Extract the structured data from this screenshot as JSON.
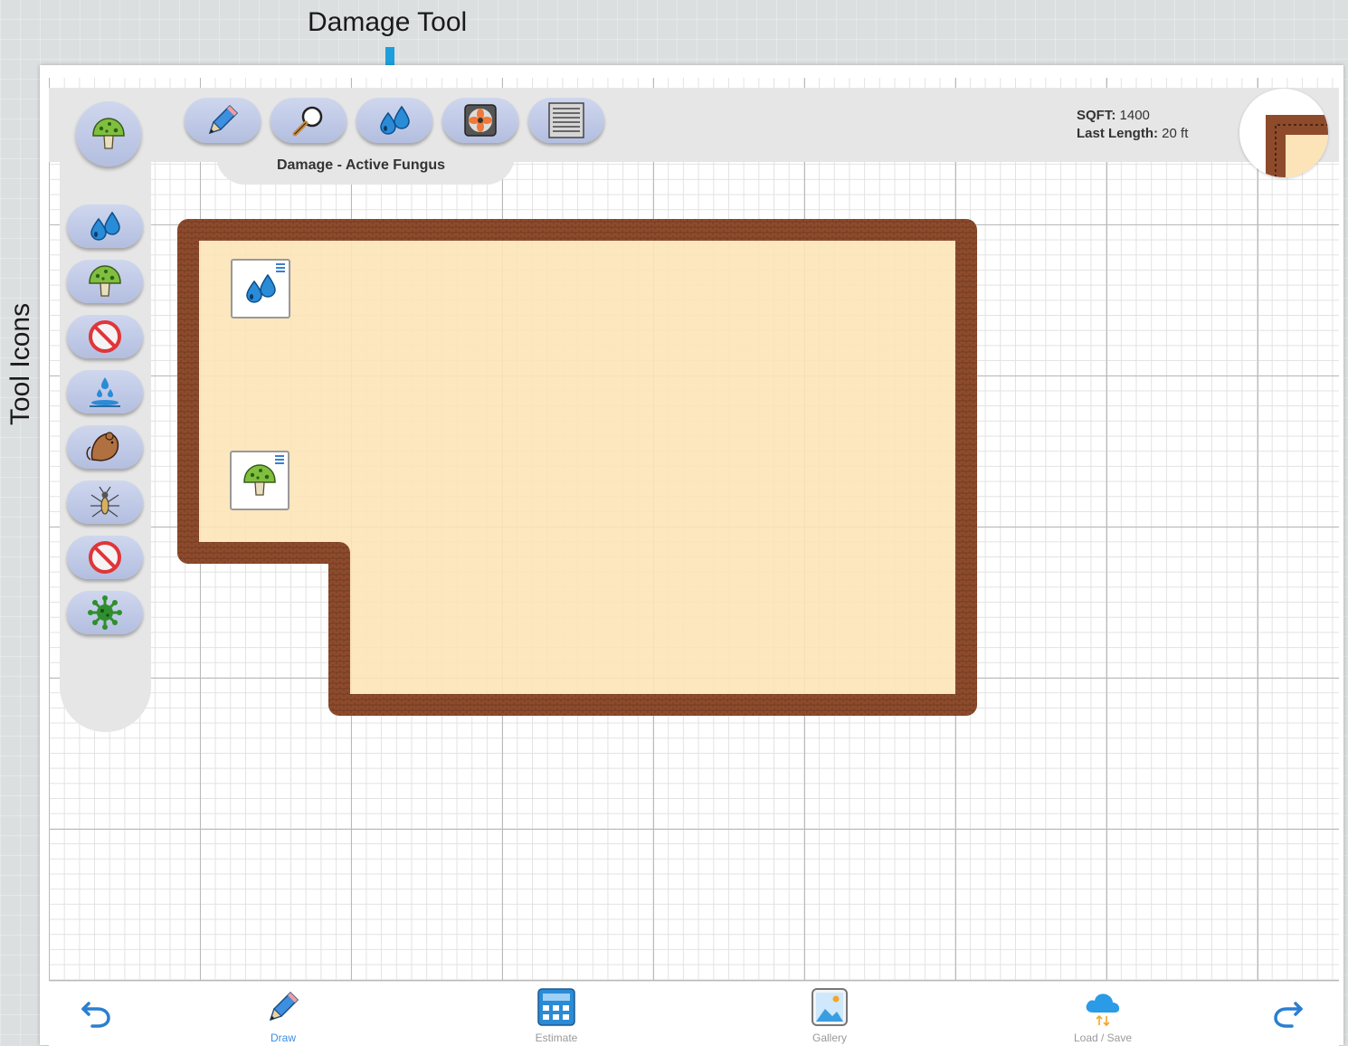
{
  "callouts": {
    "damage_tool": "Damage Tool",
    "tool_icons": "Tool Icons"
  },
  "toolbar": {
    "tools": [
      {
        "icon": "pencil-icon"
      },
      {
        "icon": "magnifier-icon"
      },
      {
        "icon": "water-drops-icon"
      },
      {
        "icon": "fan-icon"
      },
      {
        "icon": "vent-icon"
      }
    ],
    "selected_tool_caption": "Damage - Active Fungus"
  },
  "sidebar": {
    "selected_icon": "mushroom-icon",
    "items": [
      {
        "icon": "water-drops-icon"
      },
      {
        "icon": "mushroom-icon"
      },
      {
        "icon": "no-mold-icon"
      },
      {
        "icon": "water-leak-icon"
      },
      {
        "icon": "rodent-icon"
      },
      {
        "icon": "insect-icon"
      },
      {
        "icon": "no-pest-icon"
      },
      {
        "icon": "bacteria-icon"
      }
    ]
  },
  "info": {
    "sqft_label": "SQFT:",
    "sqft_value": "1400",
    "length_label": "Last Length:",
    "length_value": "20 ft"
  },
  "canvas": {
    "markers": [
      {
        "icon": "water-drops-icon"
      },
      {
        "icon": "mushroom-icon"
      }
    ]
  },
  "bottom_nav": {
    "undo_icon": "undo-icon",
    "redo_icon": "redo-icon",
    "items": [
      {
        "label": "Draw",
        "icon": "pencil-icon",
        "active": true
      },
      {
        "label": "Estimate",
        "icon": "calculator-icon",
        "active": false
      },
      {
        "label": "Gallery",
        "icon": "gallery-icon",
        "active": false
      },
      {
        "label": "Load / Save",
        "icon": "cloud-icon",
        "active": false
      }
    ]
  },
  "colors": {
    "accent": "#1d9fdc",
    "wall": "#8a4a2c",
    "floor": "#fde4b8",
    "button": "#c3cce8",
    "active_nav": "#3a8ee6"
  }
}
